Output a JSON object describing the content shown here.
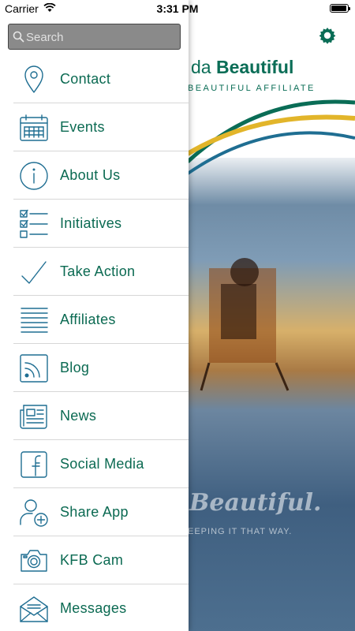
{
  "status_bar": {
    "carrier": "Carrier",
    "time": "3:31 PM"
  },
  "background_app": {
    "brand_prefix": "da",
    "brand_name": "Beautiful",
    "affiliate_text": "BEAUTIFUL AFFILIATE",
    "tagline": "Beautiful.",
    "subtagline": "EEPING IT THAT WAY.",
    "settings_icon": "gear-icon"
  },
  "drawer": {
    "search": {
      "placeholder": "Search",
      "value": ""
    },
    "items": [
      {
        "label": "Contact",
        "icon": "location-pin-icon"
      },
      {
        "label": "Events",
        "icon": "calendar-icon"
      },
      {
        "label": "About Us",
        "icon": "info-icon"
      },
      {
        "label": "Initiatives",
        "icon": "checklist-icon"
      },
      {
        "label": "Take Action",
        "icon": "checkmark-icon"
      },
      {
        "label": "Affiliates",
        "icon": "list-lines-icon"
      },
      {
        "label": "Blog",
        "icon": "rss-icon"
      },
      {
        "label": "News",
        "icon": "newspaper-icon"
      },
      {
        "label": "Social Media",
        "icon": "facebook-icon"
      },
      {
        "label": "Share App",
        "icon": "add-user-icon"
      },
      {
        "label": "KFB Cam",
        "icon": "camera-icon"
      },
      {
        "label": "Messages",
        "icon": "envelope-icon"
      }
    ]
  },
  "colors": {
    "menu_text": "#0b6a52",
    "icon_stroke": "#1f6e92",
    "search_bg": "#8a8a8a"
  }
}
